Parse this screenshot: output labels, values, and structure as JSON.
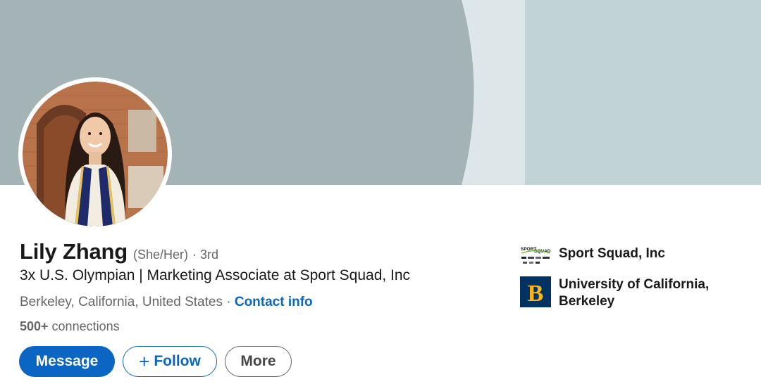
{
  "profile": {
    "name": "Lily Zhang",
    "pronouns": "(She/Her)",
    "degree": "· 3rd",
    "headline": "3x U.S. Olympian | Marketing Associate at Sport Squad, Inc",
    "location": "Berkeley, California, United States",
    "location_separator": " · ",
    "contact_info_label": "Contact info",
    "connections_count": "500+",
    "connections_label": " connections"
  },
  "actions": {
    "message_label": "Message",
    "follow_label": "Follow",
    "follow_icon": "plus-icon",
    "more_label": "More"
  },
  "organizations": [
    {
      "name": "Sport Squad, Inc",
      "logo_icon": "sport-squad-logo",
      "logo_text_1": "SPORT",
      "logo_text_2": "SQUAD"
    },
    {
      "name": "University of California, Berkeley",
      "logo_icon": "uc-berkeley-logo",
      "logo_letter": "B"
    }
  ],
  "colors": {
    "accent": "#0a66c2",
    "cover_dark": "#a4b3b6",
    "cover_light": "#dde7e9",
    "cover_right": "#c1d3d7",
    "berkeley_blue": "#003262",
    "berkeley_gold": "#fdb515"
  }
}
